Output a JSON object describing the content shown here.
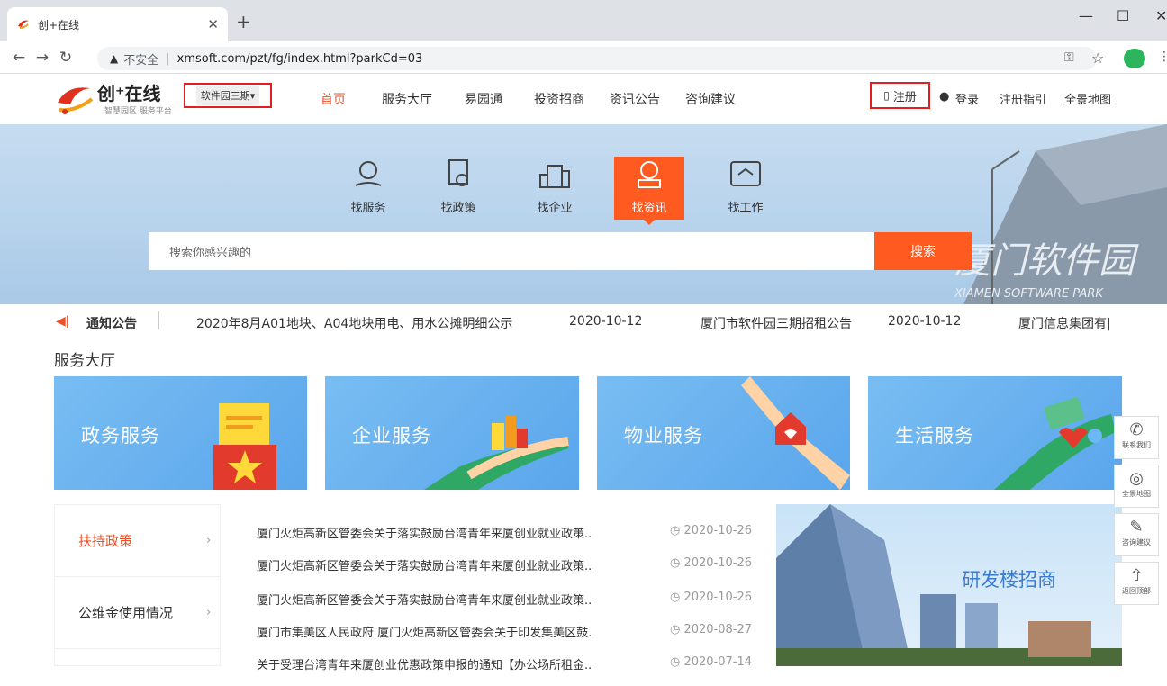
{
  "browser": {
    "tab_title": "创+在线",
    "new_tab": "+",
    "security_warn": "▲",
    "security_label": "不安全",
    "url": "xmsoft.com/pzt/fg/index.html?parkCd=03"
  },
  "header": {
    "logo_title": "创⁺在线",
    "logo_sub": "智慧园区 服务平台",
    "park_select": "软件园三期▾",
    "nav": [
      "首页",
      "服务大厅",
      "易园通",
      "投资招商",
      "资讯公告",
      "咨询建议"
    ],
    "register": "注册",
    "login": "登录",
    "register_guide": "注册指引",
    "panorama": "全景地图"
  },
  "hero": {
    "categories": [
      "找服务",
      "找政策",
      "找企业",
      "找资讯",
      "找工作"
    ],
    "active_category": "找资讯",
    "search_placeholder": "搜索你感兴趣的",
    "search_button": "搜索",
    "building_sign": "厦门软件园",
    "building_sign_en": "XIAMEN SOFTWARE PARK"
  },
  "notice": {
    "label": "通知公告",
    "items": [
      {
        "title": "2020年8月A01地块、A04地块用电、用水公摊明细公示",
        "date": "2020-10-12"
      },
      {
        "title": "厦门市软件园三期招租公告",
        "date": "2020-10-12"
      },
      {
        "title": "厦门信息集团有|",
        "date": ""
      }
    ]
  },
  "service_hall": {
    "title": "服务大厅",
    "cards": [
      "政务服务",
      "企业服务",
      "物业服务",
      "生活服务"
    ]
  },
  "policy": {
    "side_items": [
      "扶持政策",
      "公维金使用情况"
    ],
    "chevron": "›",
    "rows": [
      {
        "title": "厦门火炬高新区管委会关于落实鼓励台湾青年来厦创业就业政策...",
        "date": "2020-10-26"
      },
      {
        "title": "厦门火炬高新区管委会关于落实鼓励台湾青年来厦创业就业政策...",
        "date": "2020-10-26"
      },
      {
        "title": "厦门火炬高新区管委会关于落实鼓励台湾青年来厦创业就业政策...",
        "date": "2020-10-26"
      },
      {
        "title": "厦门市集美区人民政府 厦门火炬高新区管委会关于印发集美区鼓...",
        "date": "2020-08-27"
      },
      {
        "title": "关于受理台湾青年来厦创业优惠政策申报的通知【办公场所租金...",
        "date": "2020-07-14"
      }
    ],
    "promo_text": "研发楼招商"
  },
  "sidebar": [
    "联系我们",
    "全景地图",
    "咨询建议",
    "返回顶部"
  ],
  "colors": {
    "accent": "#ff5a1f",
    "card_blue": "#5aa6ec",
    "highlight_red": "#e02020"
  }
}
